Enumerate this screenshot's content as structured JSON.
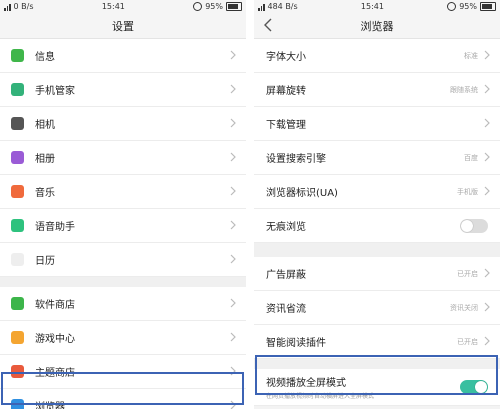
{
  "left": {
    "status": {
      "net": "0 B/s",
      "time": "15:41",
      "battery": "95%"
    },
    "title": "设置",
    "items_group1": [
      {
        "label": "信息",
        "icon": "message-icon",
        "color": "#3fb64a"
      },
      {
        "label": "手机管家",
        "icon": "phone-manager-icon",
        "color": "#33b27a"
      },
      {
        "label": "相机",
        "icon": "camera-icon",
        "color": "#555555"
      },
      {
        "label": "相册",
        "icon": "album-icon",
        "color": "#9a5bd6"
      },
      {
        "label": "音乐",
        "icon": "music-icon",
        "color": "#f06a3c"
      },
      {
        "label": "语音助手",
        "icon": "voice-assistant-icon",
        "color": "#2ec27e"
      },
      {
        "label": "日历",
        "icon": "calendar-icon",
        "color": "#eeeeee"
      }
    ],
    "items_group2": [
      {
        "label": "软件商店",
        "icon": "app-store-icon",
        "color": "#3cb54a"
      },
      {
        "label": "游戏中心",
        "icon": "game-center-icon",
        "color": "#f4a531"
      },
      {
        "label": "主题商店",
        "icon": "theme-store-icon",
        "color": "#e95a3c"
      },
      {
        "label": "浏览器",
        "icon": "browser-icon",
        "color": "#2f8fe0"
      }
    ]
  },
  "right": {
    "status": {
      "net": "484 B/s",
      "time": "15:41",
      "battery": "95%"
    },
    "title": "浏览器",
    "items_group1": [
      {
        "label": "字体大小",
        "value": "标准"
      },
      {
        "label": "屏幕旋转",
        "value": "跟随系统"
      },
      {
        "label": "下载管理",
        "value": ""
      },
      {
        "label": "设置搜索引擎",
        "value": "百度"
      },
      {
        "label": "浏览器标识(UA)",
        "value": "手机版"
      }
    ],
    "incognito": {
      "label": "无痕浏览",
      "state": "off"
    },
    "items_group2": [
      {
        "label": "广告屏蔽",
        "value": "已开启"
      },
      {
        "label": "资讯省流",
        "value": "资讯关闭"
      },
      {
        "label": "智能阅读插件",
        "value": "已开启"
      }
    ],
    "video": {
      "label": "视频播放全屏模式",
      "sub": "在网页播放视频时自动横屏进入全屏模式",
      "state": "on"
    }
  },
  "colors": {
    "accent": "#39bfa0",
    "highlight": "#3c63b4"
  }
}
